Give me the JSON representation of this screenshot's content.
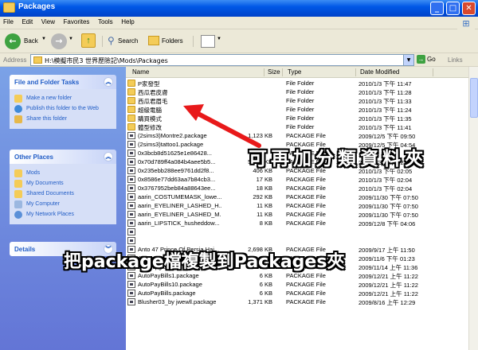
{
  "window": {
    "title": "Packages"
  },
  "menu": [
    "File",
    "Edit",
    "View",
    "Favorites",
    "Tools",
    "Help"
  ],
  "toolbar": {
    "back": "Back",
    "search": "Search",
    "folders": "Folders"
  },
  "address": {
    "label": "Address",
    "path": "H:\\模擬市民3 世界歷險記\\Mods\\Packages",
    "go": "Go",
    "links": "Links"
  },
  "panels": {
    "tasks": {
      "title": "File and Folder Tasks",
      "items": [
        "Make a new folder",
        "Publish this folder to the Web",
        "Share this folder"
      ]
    },
    "places": {
      "title": "Other Places",
      "items": [
        "Mods",
        "My Documents",
        "Shared Documents",
        "My Computer",
        "My Network Places"
      ]
    },
    "details": {
      "title": "Details"
    }
  },
  "columns": {
    "name": "Name",
    "size": "Size",
    "type": "Type",
    "date": "Date Modified"
  },
  "files": [
    {
      "name": "P家發型",
      "size": "",
      "type": "File Folder",
      "date": "2010/1/3 下午 11:47",
      "kind": "folder"
    },
    {
      "name": "西瓜君皮膚",
      "size": "",
      "type": "File Folder",
      "date": "2010/1/3 下午 11:28",
      "kind": "folder"
    },
    {
      "name": "西瓜君眉毛",
      "size": "",
      "type": "File Folder",
      "date": "2010/1/3 下午 11:33",
      "kind": "folder"
    },
    {
      "name": "超級電腦",
      "size": "",
      "type": "File Folder",
      "date": "2010/1/3 下午 11:24",
      "kind": "folder"
    },
    {
      "name": "購買模式",
      "size": "",
      "type": "File Folder",
      "date": "2010/1/3 下午 11:35",
      "kind": "folder"
    },
    {
      "name": "體型修改",
      "size": "",
      "type": "File Folder",
      "date": "2010/1/3 下午 11:41",
      "kind": "folder"
    },
    {
      "name": "(2sims3)Montre2.package",
      "size": "1,123 KB",
      "type": "PACKAGE File",
      "date": "2009/12/5 下午 09:50",
      "kind": "pkg"
    },
    {
      "name": "(2sims3)tattoo1.package",
      "size": "",
      "type": "PACKAGE File",
      "date": "2009/12/5 下午 04:54",
      "kind": "pkg"
    },
    {
      "name": "0x3bcb8d51625e1e86428...",
      "size": "",
      "type": "PACKAGE File",
      "date": "",
      "kind": "pkg"
    },
    {
      "name": "0x70d789ff4a084b4aee5b5...",
      "size": "5,683 KB",
      "type": "PACKAGE File",
      "date": "2010/1/3 下午 02:04",
      "kind": "pkg"
    },
    {
      "name": "0x235ebb288ee9761dd2f8...",
      "size": "406 KB",
      "type": "PACKAGE File",
      "date": "2010/1/3 下午 02:05",
      "kind": "pkg"
    },
    {
      "name": "0x8586e77dd63aa7b84cb3...",
      "size": "17 KB",
      "type": "PACKAGE File",
      "date": "2010/1/3 下午 02:04",
      "kind": "pkg"
    },
    {
      "name": "0x3767952beb84a88643ee...",
      "size": "18 KB",
      "type": "PACKAGE File",
      "date": "2010/1/3 下午 02:04",
      "kind": "pkg"
    },
    {
      "name": "aarin_COSTUMEMASK_lowe...",
      "size": "292 KB",
      "type": "PACKAGE File",
      "date": "2009/11/30 下午 07:50",
      "kind": "pkg"
    },
    {
      "name": "aarin_EYELINER_LASHED_H...",
      "size": "11 KB",
      "type": "PACKAGE File",
      "date": "2009/11/30 下午 07:50",
      "kind": "pkg"
    },
    {
      "name": "aarin_EYELINER_LASHED_M...",
      "size": "11 KB",
      "type": "PACKAGE File",
      "date": "2009/11/30 下午 07:50",
      "kind": "pkg"
    },
    {
      "name": "aarin_LIPSTICK_husheddow...",
      "size": "8 KB",
      "type": "PACKAGE File",
      "date": "2009/12/8 下午 04:06",
      "kind": "pkg"
    },
    {
      "name": "",
      "size": "",
      "type": "",
      "date": "",
      "kind": "pkg"
    },
    {
      "name": "",
      "size": "",
      "type": "",
      "date": "",
      "kind": "pkg"
    },
    {
      "name": "Anto 47 Prince Of Persia Hai...",
      "size": "2,698 KB",
      "type": "PACKAGE File",
      "date": "2009/9/17 上午 11:50",
      "kind": "pkg"
    },
    {
      "name": "AnyoneCanUsePottyChair.pa...",
      "size": "6 KB",
      "type": "PACKAGE File",
      "date": "2009/11/6 下午 01:23",
      "kind": "pkg"
    },
    {
      "name": "applelipgloss_by_subaxi.pa...",
      "size": "241 KB",
      "type": "PACKAGE File",
      "date": "2009/11/14 上午 11:36",
      "kind": "pkg"
    },
    {
      "name": "AutoPayBills1.package",
      "size": "6 KB",
      "type": "PACKAGE File",
      "date": "2009/12/21 上午 11:22",
      "kind": "pkg"
    },
    {
      "name": "AutoPayBills10.package",
      "size": "6 KB",
      "type": "PACKAGE File",
      "date": "2009/12/21 上午 11:22",
      "kind": "pkg"
    },
    {
      "name": "AutoPayBills.package",
      "size": "6 KB",
      "type": "PACKAGE File",
      "date": "2009/12/21 上午 11:22",
      "kind": "pkg"
    },
    {
      "name": "Blusher03_by jwewll.package",
      "size": "1,371 KB",
      "type": "PACKAGE File",
      "date": "2009/8/16 上午 12:29",
      "kind": "pkg"
    }
  ],
  "overlay": {
    "caption1": "可再加分類資料夾",
    "caption2": "把package檔複製到Packages夾"
  },
  "colors": {
    "arrow": "#e8191a",
    "caption_text": "#ffffff",
    "caption_outline": "#000000"
  }
}
